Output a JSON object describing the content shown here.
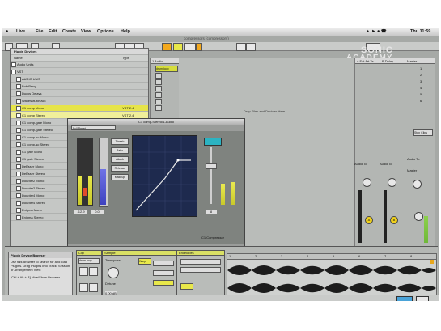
{
  "menubar": {
    "apple": "",
    "app": "Live",
    "items": [
      "File",
      "Edit",
      "Create",
      "View",
      "Options",
      "Help"
    ],
    "clock": "Thu 11:59"
  },
  "toolbar": {
    "title": "compressors (compressors)"
  },
  "browser": {
    "title": "Plugin Devices",
    "col_name": "Name",
    "col_type": "Type",
    "rows": [
      "Audio Units",
      "VST",
      "AUDIO UNIT",
      "Bob Perry",
      "Ducks Delays",
      "WavesMultiRack",
      "C1 comp Mono",
      "C1 comp Stereo",
      "C1 comp-gate Mono",
      "C1 comp-gate Stereo",
      "C1 comp-sc Mono",
      "C1 comp-sc Stereo",
      "C1 gate Mono",
      "C1 gate Stereo",
      "DeEsser Mono",
      "DeEsser Stereo",
      "Doubler2 Mono",
      "Doubler2 Stereo",
      "Doubler4 Mono",
      "Doubler4 Stereo",
      "Enigma Mono",
      "Enigma Stereo"
    ],
    "row_types": [
      "",
      "",
      "",
      "",
      "",
      "",
      "VST 2.4",
      "VST 2.4",
      "",
      "",
      "",
      "",
      "",
      "",
      "",
      "",
      "",
      "",
      "",
      "",
      "",
      ""
    ]
  },
  "session": {
    "track1": "1 Audio",
    "drop_text": "Drop Files and Devices Here",
    "returnA": "A Ext Art Te",
    "returnB": "B Delay",
    "master": "Master",
    "clip": "drum loop",
    "audio_to": "Audio To",
    "master_label": "Master",
    "slot_numbers": [
      "1",
      "2",
      "3",
      "4",
      "5",
      "6"
    ],
    "track_nums": [
      "1",
      "A",
      "B"
    ],
    "stop_all": "Stop Clips"
  },
  "plugin": {
    "title": "C1 comp-Stereo/1-Audio",
    "preset": "Full Reset",
    "bottom_label": "C1 Compressor",
    "button_labels": [
      "Thresh",
      "Ratio",
      "Attack",
      "Release",
      "Makeup"
    ],
    "values": [
      "-12.9",
      "0.0",
      "8"
    ]
  },
  "brand": {
    "line1": "SONIC",
    "line2": "ACADEMY"
  },
  "detail": {
    "info_title": "Plugin Device Browser",
    "info_text": "Use this Browser to search for and load Plugins. Drag Plugins into Track, Session or Arrangement View.",
    "info_footer": "[Ctrl + Alt + B] Hide/Show Browser",
    "panel1_title": "Clip",
    "panel2_title": "Sample",
    "panel3_title": "Envelopes",
    "clip_name": "drum loop",
    "transpose": "Transpose",
    "detune": "Detune",
    "volume": "0.00 dB",
    "warp": "Warp",
    "ruler": [
      "1",
      "2",
      "3",
      "4",
      "5",
      "6",
      "7",
      "8"
    ]
  }
}
